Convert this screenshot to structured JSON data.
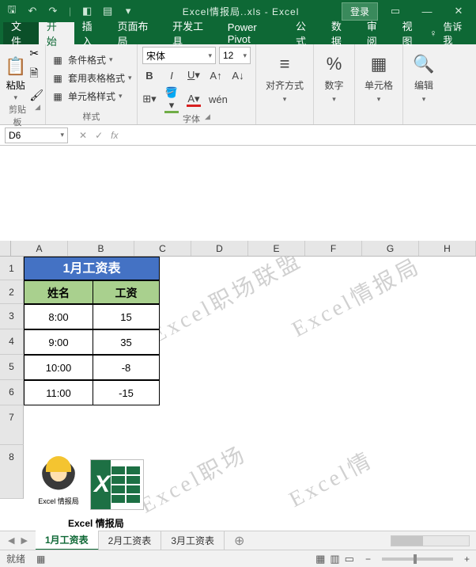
{
  "titlebar": {
    "filename": "Excel情报局..xls  -  Excel",
    "login": "登录"
  },
  "tabs": {
    "file": "文件",
    "home": "开始",
    "insert": "插入",
    "layout": "页面布局",
    "dev": "开发工具",
    "powerpivot": "Power Pivot",
    "formulas": "公式",
    "data": "数据",
    "review": "审阅",
    "view": "视图",
    "tellme": "告诉我"
  },
  "ribbon": {
    "clipboard": {
      "paste": "粘贴",
      "label": "剪贴板"
    },
    "styles": {
      "conditional": "条件格式",
      "tableformat": "套用表格格式",
      "cellstyles": "单元格样式",
      "label": "样式"
    },
    "font": {
      "name": "宋体",
      "size": "12",
      "label": "字体",
      "wen": "wén"
    },
    "align": {
      "btn": "对齐方式",
      "label": ""
    },
    "number": {
      "btn": "数字",
      "label": ""
    },
    "cells": {
      "btn": "单元格",
      "label": ""
    },
    "editing": {
      "btn": "编辑",
      "label": ""
    }
  },
  "formula_bar": {
    "namebox": "D6",
    "fx": "fx"
  },
  "columns": [
    "A",
    "B",
    "C",
    "D",
    "E",
    "F",
    "G",
    "H"
  ],
  "rows": [
    "1",
    "2",
    "3",
    "4",
    "5",
    "6",
    "7",
    "8"
  ],
  "table": {
    "title": "1月工资表",
    "headers": {
      "name": "姓名",
      "salary": "工资"
    },
    "data": [
      {
        "a": "8:00",
        "b": "15"
      },
      {
        "a": "9:00",
        "b": "35"
      },
      {
        "a": "10:00",
        "b": "-8"
      },
      {
        "a": "11:00",
        "b": "-15"
      }
    ]
  },
  "logos": {
    "caption1": "Excel 情报局",
    "caption2": "Excel 情报局"
  },
  "watermarks": [
    "Excel职场联盟",
    "Excel情报局",
    "Excel职场",
    "Excel情"
  ],
  "sheet_tabs": {
    "s1": "1月工资表",
    "s2": "2月工资表",
    "s3": "3月工资表"
  },
  "statusbar": {
    "ready": "就绪",
    "zoom_out": "−",
    "zoom_in": "+"
  },
  "chart_data": {
    "type": "table",
    "title": "1月工资表",
    "columns": [
      "姓名",
      "工资"
    ],
    "rows": [
      [
        "8:00",
        15
      ],
      [
        "9:00",
        35
      ],
      [
        "10:00",
        -8
      ],
      [
        "11:00",
        -15
      ]
    ]
  }
}
